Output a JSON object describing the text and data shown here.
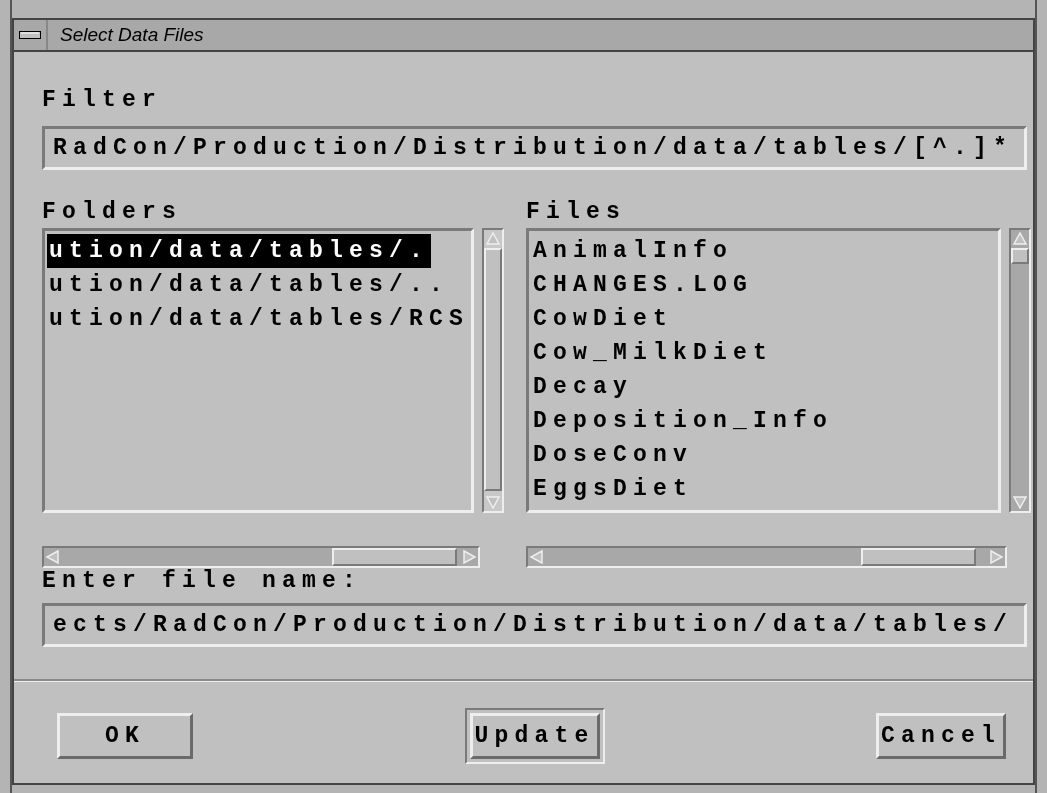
{
  "window": {
    "title": "Select Data Files"
  },
  "filter": {
    "label": "Filter",
    "value": "RadCon/Production/Distribution/data/tables/[^.]*"
  },
  "folders": {
    "label": "Folders",
    "items": [
      {
        "text": "ution/data/tables/.",
        "selected": true
      },
      {
        "text": "ution/data/tables/..",
        "selected": false
      },
      {
        "text": "ution/data/tables/RCS",
        "selected": false
      }
    ]
  },
  "files": {
    "label": "Files",
    "items": [
      {
        "text": "AnimalInfo",
        "selected": false
      },
      {
        "text": "CHANGES.LOG",
        "selected": false
      },
      {
        "text": "CowDiet",
        "selected": false
      },
      {
        "text": "Cow_MilkDiet",
        "selected": false
      },
      {
        "text": "Decay",
        "selected": false
      },
      {
        "text": "Deposition_Info",
        "selected": false
      },
      {
        "text": "DoseConv",
        "selected": false
      },
      {
        "text": "EggsDiet",
        "selected": false
      }
    ]
  },
  "selection": {
    "label": "Enter file name:",
    "value": "ects/RadCon/Production/Distribution/data/tables/"
  },
  "buttons": [
    {
      "label": "OK",
      "default": false
    },
    {
      "label": "Update",
      "default": true
    },
    {
      "label": "Cancel",
      "default": false
    }
  ]
}
